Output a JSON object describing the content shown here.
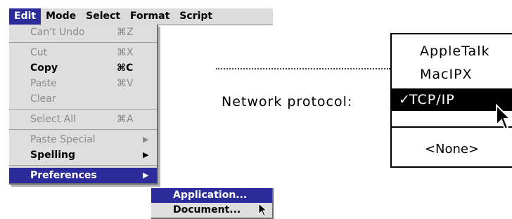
{
  "menubar": {
    "titles": [
      "Edit",
      "Mode",
      "Select",
      "Format",
      "Script"
    ]
  },
  "edit_menu": {
    "cant_undo": {
      "label": "Can't Undo",
      "key": "⌘Z"
    },
    "cut": {
      "label": "Cut",
      "key": "⌘X"
    },
    "copy": {
      "label": "Copy",
      "key": "⌘C"
    },
    "paste": {
      "label": "Paste",
      "key": "⌘V"
    },
    "clear": {
      "label": "Clear"
    },
    "select_all": {
      "label": "Select All",
      "key": "⌘A"
    },
    "paste_special": {
      "label": "Paste Special",
      "arrow": "▶"
    },
    "spelling": {
      "label": "Spelling",
      "arrow": "▶"
    },
    "preferences": {
      "label": "Preferences",
      "arrow": "▶"
    }
  },
  "preferences_submenu": {
    "application": "Application...",
    "document": "Document..."
  },
  "network": {
    "label": "Network protocol:",
    "options": [
      "AppleTalk",
      "MacIPX",
      "TCP/IP"
    ],
    "selected": "TCP/IP",
    "check": "✓",
    "none": "<None>"
  },
  "colors": {
    "highlight": "#2b2b9c",
    "menu_bg": "#dedede",
    "disabled": "#8a8a8a"
  },
  "icons": [
    "chevron-right-icon",
    "checkmark-icon",
    "arrow-pointer-icon"
  ]
}
